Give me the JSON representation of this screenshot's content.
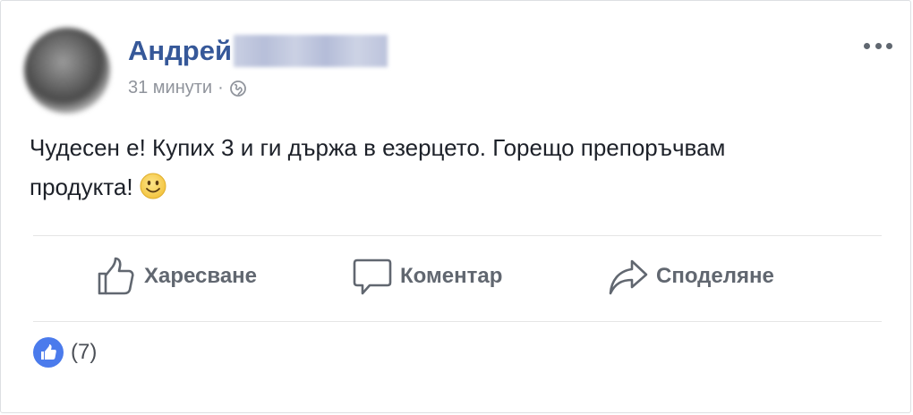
{
  "post": {
    "author_first_name": "Андрей",
    "timestamp": "31 минути",
    "separator": "·",
    "text": "Чудесен е! Купих 3 и ги държа в езерцето. Горещо препоръчвам продукта!",
    "emoji": "smiley"
  },
  "actions": {
    "like_label": "Харесване",
    "comment_label": "Коментар",
    "share_label": "Споделяне"
  },
  "reactions": {
    "count_text": "(7)"
  },
  "icons": {
    "privacy": "globe-icon",
    "menu": "more-options-icon",
    "reaction": "like-reaction-icon"
  },
  "colors": {
    "author": "#365899",
    "meta": "#90949c",
    "action_text": "#616770",
    "like_badge": "#4b7bec"
  }
}
